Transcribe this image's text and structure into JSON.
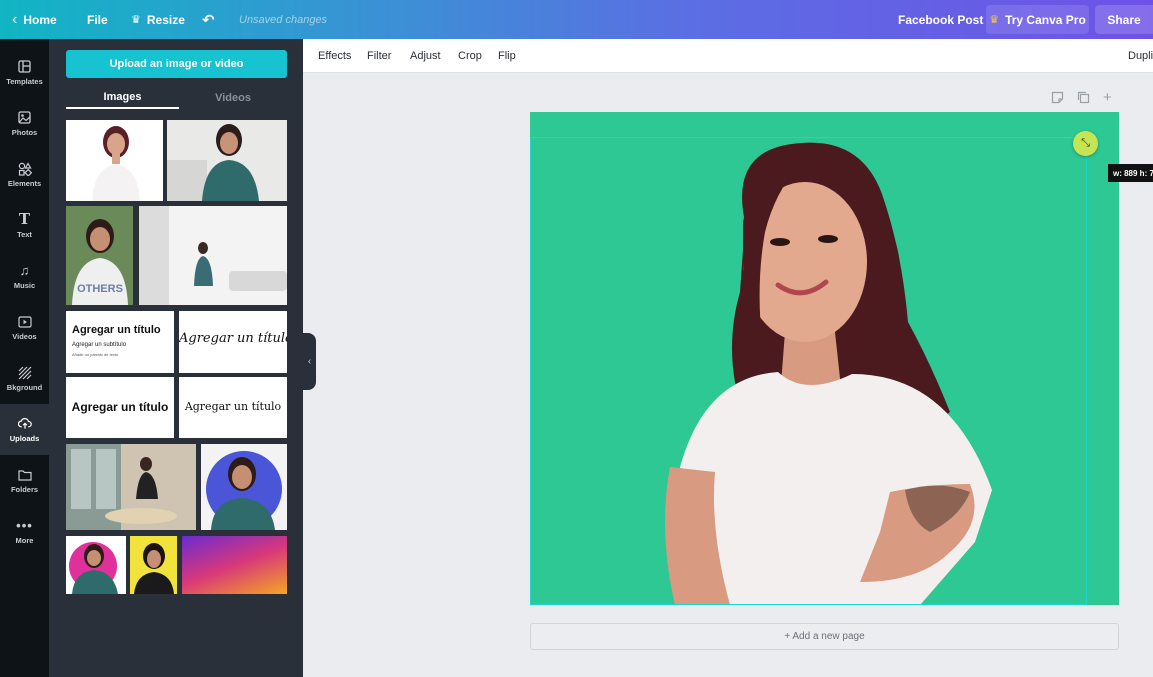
{
  "topbar": {
    "home_label": "Home",
    "file_label": "File",
    "resize_label": "Resize",
    "unsaved_text": "Unsaved changes",
    "doc_type": "Facebook Post",
    "pro_label": "Try Canva Pro",
    "share_label": "Share"
  },
  "rail": [
    {
      "label": "Templates",
      "icon": "templates-icon"
    },
    {
      "label": "Photos",
      "icon": "photos-icon"
    },
    {
      "label": "Elements",
      "icon": "elements-icon"
    },
    {
      "label": "Text",
      "icon": "text-icon"
    },
    {
      "label": "Music",
      "icon": "music-icon"
    },
    {
      "label": "Videos",
      "icon": "videos-icon"
    },
    {
      "label": "Bkground",
      "icon": "background-icon"
    },
    {
      "label": "Uploads",
      "icon": "uploads-icon",
      "active": true
    },
    {
      "label": "Folders",
      "icon": "folders-icon"
    },
    {
      "label": "More",
      "icon": "more-icon"
    }
  ],
  "panel": {
    "upload_label": "Upload an image or video",
    "tab_images": "Images",
    "tab_videos": "Videos",
    "text_thumbs": {
      "title1": "Agregar un título",
      "subtitle1": "Agregar un subtítulo",
      "small1": "Añadir un párrafo de texto",
      "title2": "Agregar un título",
      "title3": "Agregar un título",
      "title4": "Agregar un título"
    },
    "shirt_text": "OTHERS"
  },
  "editor_toolbar": {
    "effects": "Effects",
    "filter": "Filter",
    "adjust": "Adjust",
    "crop": "Crop",
    "flip": "Flip",
    "duplicate": "Dupli"
  },
  "canvas": {
    "background_color": "#2ec895",
    "dimension_tooltip": "w: 889 h: 7",
    "add_page_label": "+ Add a new page"
  }
}
